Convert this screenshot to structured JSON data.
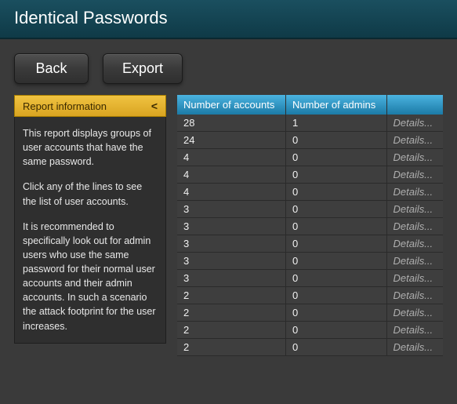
{
  "header": {
    "title": "Identical Passwords"
  },
  "toolbar": {
    "back_label": "Back",
    "export_label": "Export"
  },
  "sidebar": {
    "panel_title": "Report information",
    "chev": "<",
    "p1": "This report displays groups of user accounts that have the same password.",
    "p2": "Click any of the lines to see the list of user accounts.",
    "p3": "It is recommended to specifically look out for admin users who use the same password for their normal user accounts and their admin accounts. In such a scenario the attack footprint for the user increases."
  },
  "table": {
    "col_accounts": "Number of accounts",
    "col_admins": "Number of admins",
    "col_details": "",
    "details_label": "Details...",
    "rows": [
      {
        "accounts": "28",
        "admins": "1"
      },
      {
        "accounts": "24",
        "admins": "0"
      },
      {
        "accounts": "4",
        "admins": "0"
      },
      {
        "accounts": "4",
        "admins": "0"
      },
      {
        "accounts": "4",
        "admins": "0"
      },
      {
        "accounts": "3",
        "admins": "0"
      },
      {
        "accounts": "3",
        "admins": "0"
      },
      {
        "accounts": "3",
        "admins": "0"
      },
      {
        "accounts": "3",
        "admins": "0"
      },
      {
        "accounts": "3",
        "admins": "0"
      },
      {
        "accounts": "2",
        "admins": "0"
      },
      {
        "accounts": "2",
        "admins": "0"
      },
      {
        "accounts": "2",
        "admins": "0"
      },
      {
        "accounts": "2",
        "admins": "0"
      }
    ]
  }
}
